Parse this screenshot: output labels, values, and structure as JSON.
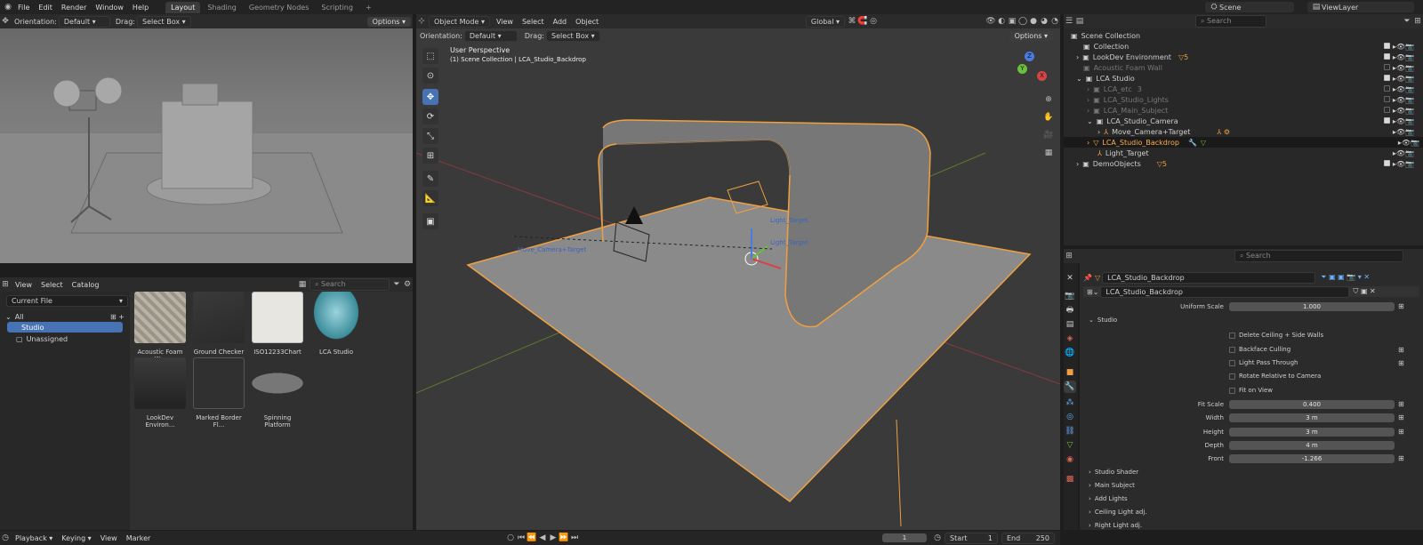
{
  "top_menu": {
    "file": "File",
    "edit": "Edit",
    "render": "Render",
    "window": "Window",
    "help": "Help"
  },
  "workspaces": [
    "Layout",
    "Shading",
    "Geometry Nodes",
    "Scripting"
  ],
  "workspace_add": "+",
  "scene": {
    "name": "Scene",
    "view_layer": "ViewLayer"
  },
  "left_view": {
    "orientation_label": "Orientation:",
    "orientation_value": "Default",
    "drag_label": "Drag:",
    "drag_value": "Select Box",
    "options": "Options"
  },
  "asset_browser": {
    "view": "View",
    "select": "Select",
    "catalog": "Catalog",
    "search_placeholder": "Search",
    "library": "Current File",
    "catalogs": {
      "all": "All",
      "studio": "Studio",
      "unassigned": "Unassigned"
    },
    "assets": [
      "Acoustic Foam W...",
      "Ground Checker",
      "ISO12233Chart",
      "LCA Studio",
      "LookDev Environ...",
      "Marked Border Fl...",
      "Spinning Platform"
    ]
  },
  "viewport": {
    "mode": "Object Mode",
    "view": "View",
    "select": "Select",
    "add": "Add",
    "object": "Object",
    "transform": "Global",
    "orientation_label": "Orientation:",
    "orientation_value": "Default",
    "drag_label": "Drag:",
    "drag_value": "Select Box",
    "options": "Options",
    "title": "User Perspective",
    "subtitle": "(1) Scene Collection | LCA_Studio_Backdrop",
    "labels": {
      "camera_target": "Move_Camera+Target",
      "light_target": "Light_Target",
      "light_target2": "Light_Target"
    },
    "axes": {
      "x": "X",
      "y": "Y",
      "z": "Z"
    }
  },
  "outliner": {
    "search_placeholder": "Search",
    "root": "Scene Collection",
    "items": [
      {
        "name": "Collection",
        "badge": ""
      },
      {
        "name": "LookDev Environment",
        "badge": "5"
      },
      {
        "name": "Acoustic Foam Wall",
        "badge": ""
      },
      {
        "name": "LCA Studio",
        "badge": ""
      },
      {
        "name": "LCA_etc",
        "badge": "3"
      },
      {
        "name": "LCA_Studio_Lights",
        "badge": ""
      },
      {
        "name": "LCA_Main_Subject",
        "badge": ""
      },
      {
        "name": "LCA_Studio_Camera",
        "badge": ""
      },
      {
        "name": "Move_Camera+Target",
        "badge": ""
      },
      {
        "name": "LCA_Studio_Backdrop",
        "badge": ""
      },
      {
        "name": "Light_Target",
        "badge": ""
      },
      {
        "name": "DemoObjects",
        "badge": "5"
      }
    ]
  },
  "properties": {
    "search_placeholder": "Search",
    "object": "LCA_Studio_Backdrop",
    "modifier": "LCA_Studio_Backdrop",
    "uniform_scale_label": "Uniform Scale",
    "uniform_scale": "1.000",
    "studio": "Studio",
    "checks": {
      "delete_ceiling": "Delete Ceiling + Side Walls",
      "backface": "Backface Culling",
      "light_pass": "Light Pass Through",
      "rotate_rel": "Rotate Relative to Camera",
      "fit_on_view": "Fit on View"
    },
    "fit_scale_label": "Fit Scale",
    "fit_scale": "0.400",
    "width_label": "Width",
    "width": "3 m",
    "height_label": "Height",
    "height": "3 m",
    "depth_label": "Depth",
    "depth": "4 m",
    "front_label": "Front",
    "front": "-1.266",
    "sections": [
      "Studio Shader",
      "Main Subject",
      "Add Lights",
      "Ceiling Light adj.",
      "Right Light adj."
    ]
  },
  "timeline": {
    "playback": "Playback",
    "keying": "Keying",
    "view": "View",
    "marker": "Marker",
    "frame": "1",
    "start_label": "Start",
    "start": "1",
    "end_label": "End",
    "end": "250"
  },
  "colors": {
    "accent": "#4772b3",
    "selection": "#f0a040",
    "active_text": "#ffaf4d"
  }
}
